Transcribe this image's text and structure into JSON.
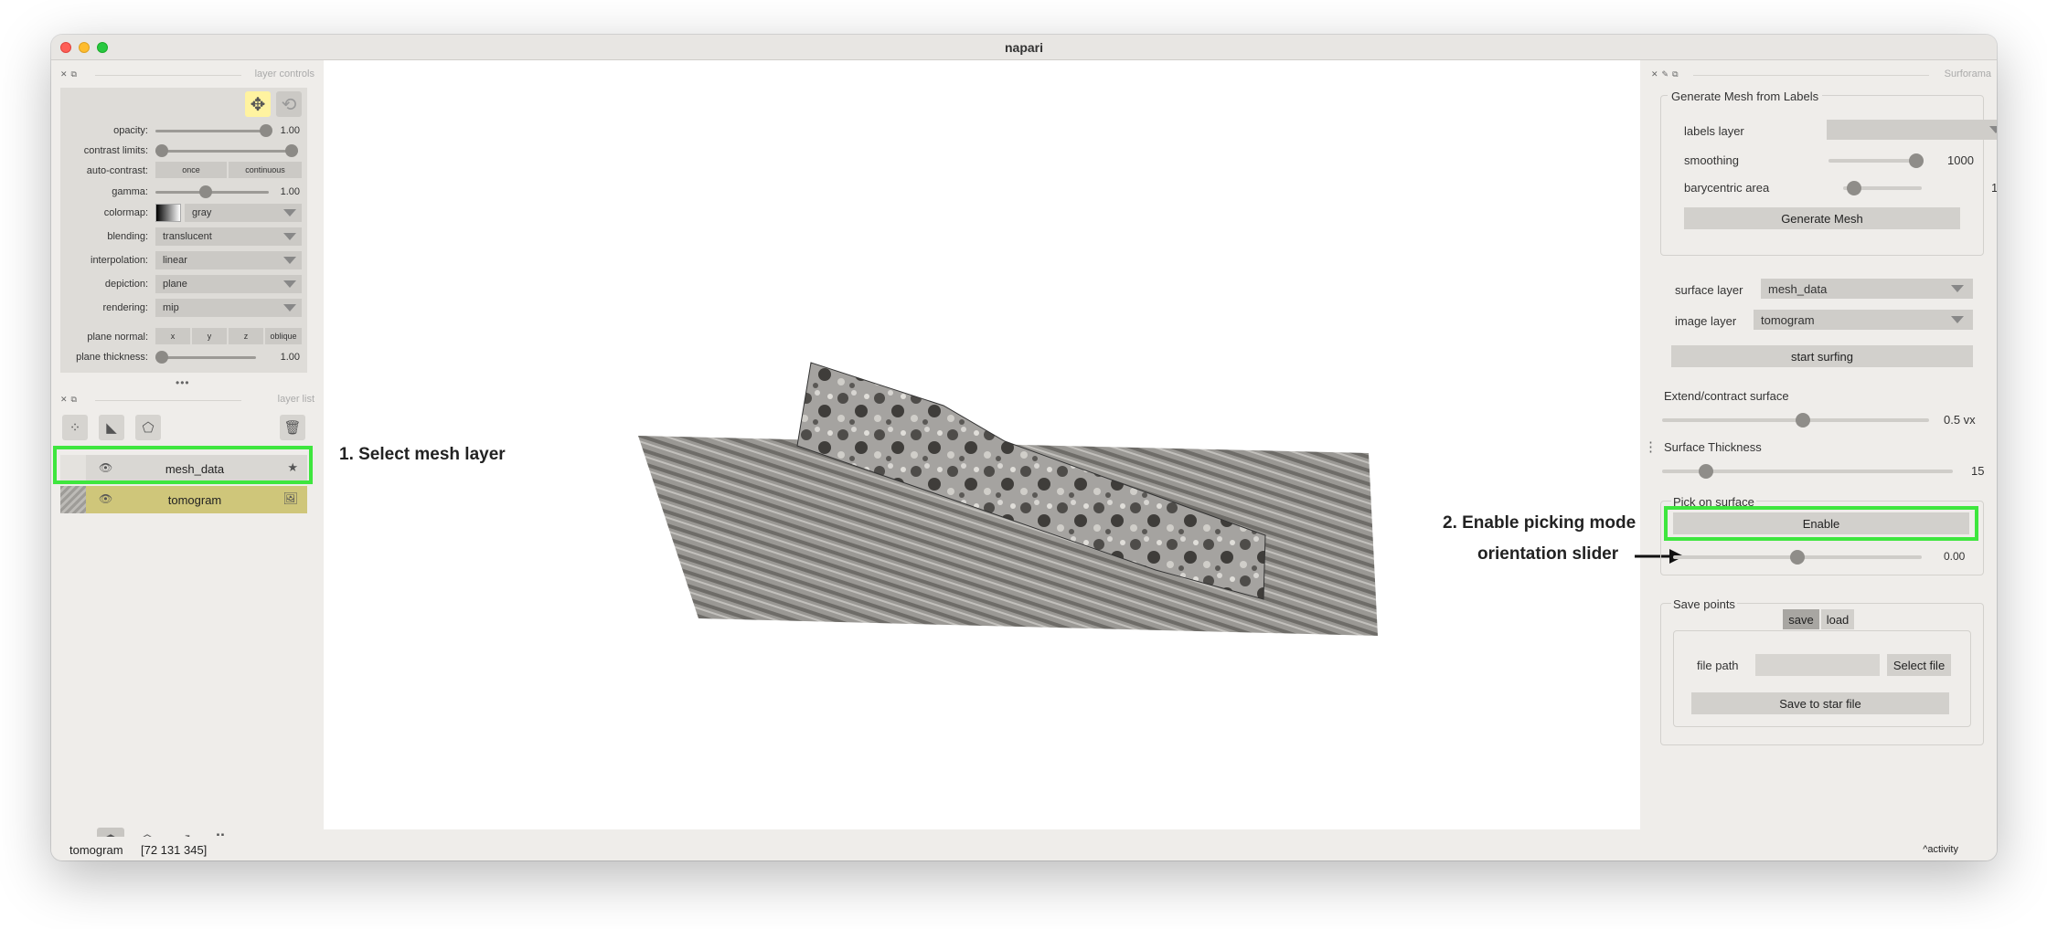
{
  "window": {
    "title": "napari"
  },
  "left_dock": {
    "layer_controls_title": "layer controls",
    "layer_list_title": "layer list",
    "controls": {
      "opacity": {
        "label": "opacity:",
        "value": "1.00",
        "level": 1.0
      },
      "contrast_limits": {
        "label": "contrast limits:",
        "range": [
          0.0,
          1.0
        ]
      },
      "auto_contrast": {
        "label": "auto-contrast:",
        "once": "once",
        "continuous": "continuous"
      },
      "gamma": {
        "label": "gamma:",
        "value": "1.00",
        "level": 0.45
      },
      "colormap": {
        "label": "colormap:",
        "value": "gray"
      },
      "blending": {
        "label": "blending:",
        "value": "translucent"
      },
      "interpolation": {
        "label": "interpolation:",
        "value": "linear"
      },
      "depiction": {
        "label": "depiction:",
        "value": "plane"
      },
      "rendering": {
        "label": "rendering:",
        "value": "mip"
      },
      "plane_normal": {
        "label": "plane normal:",
        "x": "x",
        "y": "y",
        "z": "z",
        "oblique": "oblique"
      },
      "plane_thickness": {
        "label": "plane thickness:",
        "value": "1.00",
        "level": 0.0
      }
    },
    "more_handle": "•••",
    "layers": [
      {
        "name": "mesh_data",
        "type_icon": "star",
        "selected": true
      },
      {
        "name": "tomogram",
        "type_icon": "image",
        "selected": false
      }
    ]
  },
  "annotations": {
    "select_mesh": "1. Select mesh layer",
    "enable_picking": "2. Enable picking mode",
    "orientation_slider": "orientation slider"
  },
  "surforama": {
    "title": "Surforama",
    "generate_group": {
      "title": "Generate Mesh from Labels",
      "labels_layer_label": "labels layer",
      "labels_layer_value": "",
      "smoothing_label": "smoothing",
      "smoothing_value": "1000",
      "smoothing_level": 0.9,
      "barycentric_label": "barycentric area",
      "barycentric_value": "1",
      "barycentric_level": 0.05,
      "generate_button": "Generate Mesh"
    },
    "surface_group": {
      "surface_layer_label": "surface layer",
      "surface_layer_value": "mesh_data",
      "image_layer_label": "image layer",
      "image_layer_value": "tomogram",
      "start_button": "start surfing",
      "extend_label": "Extend/contract surface",
      "extend_value": "0.5 vx",
      "extend_level": 0.52,
      "thickness_label": "Surface Thickness",
      "thickness_value": "15",
      "thickness_level": 0.15
    },
    "pick_group": {
      "title": "Pick on surface",
      "enable_button": "Enable",
      "orientation_value": "0.00",
      "orientation_level": 0.5
    },
    "save_group": {
      "title": "Save points",
      "tab_save": "save",
      "tab_load": "load",
      "file_path_label": "file path",
      "file_path_value": "",
      "select_file_button": "Select file",
      "save_star_button": "Save to star file"
    }
  },
  "status_bar": {
    "layer": "tomogram",
    "coords": "[72 131 345]",
    "activity": "activity"
  }
}
